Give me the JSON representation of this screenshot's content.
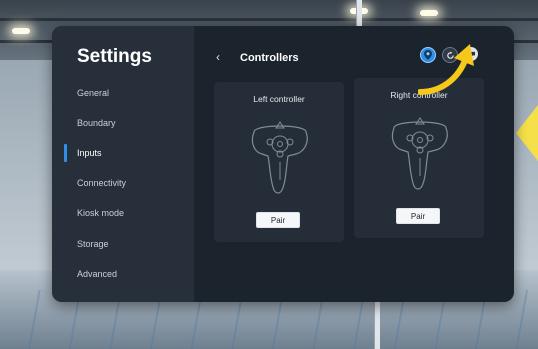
{
  "sidebar": {
    "title": "Settings",
    "items": [
      {
        "label": "General"
      },
      {
        "label": "Boundary"
      },
      {
        "label": "Inputs"
      },
      {
        "label": "Connectivity"
      },
      {
        "label": "Kiosk mode"
      },
      {
        "label": "Storage"
      },
      {
        "label": "Advanced"
      }
    ],
    "active_item": "Inputs"
  },
  "header": {
    "back_icon": "chevron-left-icon",
    "title": "Controllers",
    "icons": [
      "location-pin-icon",
      "refresh-icon",
      "headset-icon"
    ]
  },
  "controllers": [
    {
      "label": "Left controller",
      "button": "Pair"
    },
    {
      "label": "Right controller",
      "button": "Pair"
    }
  ],
  "colors": {
    "accent": "#2f8fe6",
    "panel_bg": "#1b232c",
    "sidebar_bg": "#27303a",
    "annotation_arrow": "#f5c81b"
  }
}
